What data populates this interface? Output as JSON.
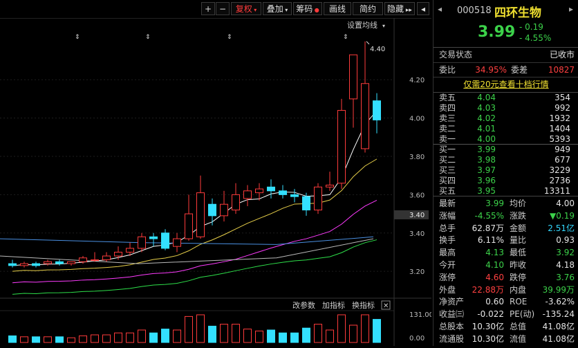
{
  "toolbar": {
    "plus": "+",
    "minus": "−",
    "fuquan": "复权",
    "diejia": "叠加",
    "chouma": "筹码",
    "huaxian": "画线",
    "jianyue": "简约",
    "yincang": "隐藏",
    "more": "▸▸"
  },
  "chart": {
    "settings_label": "设置均线",
    "peak_label": "4.40",
    "current_price_tag": "3.40",
    "price_ticks": [
      {
        "label": "4.20",
        "value": 4.2
      },
      {
        "label": "4.00",
        "value": 4.0
      },
      {
        "label": "3.80",
        "value": 3.8
      },
      {
        "label": "3.60",
        "value": 3.6
      },
      {
        "label": "3.40",
        "value": 3.4
      },
      {
        "label": "3.20",
        "value": 3.2
      }
    ],
    "indicator_buttons": [
      "改参数",
      "加指标",
      "换指标"
    ],
    "close_icon": "✕",
    "vol_ticks": [
      "131.00",
      "0.00"
    ]
  },
  "chart_data": {
    "type": "candlestick",
    "ylim": [
      3.15,
      4.45
    ],
    "candles": [
      {
        "o": 3.24,
        "h": 3.26,
        "l": 3.22,
        "c": 3.23
      },
      {
        "o": 3.23,
        "h": 3.25,
        "l": 3.22,
        "c": 3.24
      },
      {
        "o": 3.24,
        "h": 3.25,
        "l": 3.22,
        "c": 3.23
      },
      {
        "o": 3.24,
        "h": 3.26,
        "l": 3.23,
        "c": 3.25
      },
      {
        "o": 3.25,
        "h": 3.26,
        "l": 3.23,
        "c": 3.24
      },
      {
        "o": 3.24,
        "h": 3.25,
        "l": 3.23,
        "c": 3.25
      },
      {
        "o": 3.25,
        "h": 3.28,
        "l": 3.24,
        "c": 3.27
      },
      {
        "o": 3.26,
        "h": 3.3,
        "l": 3.25,
        "c": 3.26
      },
      {
        "o": 3.26,
        "h": 3.3,
        "l": 3.25,
        "c": 3.28
      },
      {
        "o": 3.28,
        "h": 3.33,
        "l": 3.26,
        "c": 3.3
      },
      {
        "o": 3.3,
        "h": 3.35,
        "l": 3.28,
        "c": 3.32
      },
      {
        "o": 3.32,
        "h": 3.4,
        "l": 3.3,
        "c": 3.38
      },
      {
        "o": 3.38,
        "h": 3.4,
        "l": 3.33,
        "c": 3.37
      },
      {
        "o": 3.4,
        "h": 3.42,
        "l": 3.31,
        "c": 3.32
      },
      {
        "o": 3.33,
        "h": 3.4,
        "l": 3.3,
        "c": 3.37
      },
      {
        "o": 3.37,
        "h": 3.6,
        "l": 3.36,
        "c": 3.5
      },
      {
        "o": 3.38,
        "h": 3.7,
        "l": 3.37,
        "c": 3.61
      },
      {
        "o": 3.55,
        "h": 3.58,
        "l": 3.44,
        "c": 3.49
      },
      {
        "o": 3.49,
        "h": 3.62,
        "l": 3.46,
        "c": 3.55
      },
      {
        "o": 3.52,
        "h": 3.66,
        "l": 3.5,
        "c": 3.6
      },
      {
        "o": 3.58,
        "h": 3.65,
        "l": 3.54,
        "c": 3.62
      },
      {
        "o": 3.61,
        "h": 3.66,
        "l": 3.57,
        "c": 3.63
      },
      {
        "o": 3.64,
        "h": 3.68,
        "l": 3.58,
        "c": 3.62
      },
      {
        "o": 3.62,
        "h": 3.65,
        "l": 3.58,
        "c": 3.6
      },
      {
        "o": 3.6,
        "h": 3.63,
        "l": 3.56,
        "c": 3.59
      },
      {
        "o": 3.59,
        "h": 3.61,
        "l": 3.49,
        "c": 3.52
      },
      {
        "o": 3.52,
        "h": 3.66,
        "l": 3.5,
        "c": 3.64
      },
      {
        "o": 3.64,
        "h": 3.72,
        "l": 3.62,
        "c": 3.65
      },
      {
        "o": 3.66,
        "h": 4.1,
        "l": 3.63,
        "c": 4.04
      },
      {
        "o": 4.1,
        "h": 4.1,
        "l": 3.95,
        "c": 4.33
      },
      {
        "o": 3.84,
        "h": 4.4,
        "l": 3.82,
        "c": 4.18
      },
      {
        "o": 4.09,
        "h": 4.13,
        "l": 3.92,
        "c": 3.99
      }
    ],
    "current_price": 3.99
  },
  "panel": {
    "code": "000518",
    "name": "四环生物",
    "price": "3.99",
    "change": "- 0.19",
    "change_pct": "- 4.55%",
    "trade_status_label": "交易状态",
    "trade_status_value": "已收市",
    "weibi_label": "委比",
    "weibi_value": "34.95%",
    "weicha_label": "委差",
    "weicha_value": "10827",
    "promo": "仅需20元查看十档行情",
    "asks": [
      {
        "label": "卖五",
        "price": "4.04",
        "vol": "354"
      },
      {
        "label": "卖四",
        "price": "4.03",
        "vol": "992"
      },
      {
        "label": "卖三",
        "price": "4.02",
        "vol": "1932"
      },
      {
        "label": "卖二",
        "price": "4.01",
        "vol": "1404"
      },
      {
        "label": "卖一",
        "price": "4.00",
        "vol": "5393"
      }
    ],
    "bids": [
      {
        "label": "买一",
        "price": "3.99",
        "vol": "949"
      },
      {
        "label": "买二",
        "price": "3.98",
        "vol": "677"
      },
      {
        "label": "买三",
        "price": "3.97",
        "vol": "3229"
      },
      {
        "label": "买四",
        "price": "3.96",
        "vol": "2736"
      },
      {
        "label": "买五",
        "price": "3.95",
        "vol": "13311"
      }
    ],
    "stats": [
      {
        "l1": "最新",
        "v1": "3.99",
        "c1": "grn",
        "l2": "均价",
        "v2": "4.00",
        "c2": "wht"
      },
      {
        "l1": "涨幅",
        "v1": "-4.55%",
        "c1": "grn",
        "l2": "涨跌",
        "v2": "▼0.19",
        "c2": "grn"
      },
      {
        "l1": "总手",
        "v1": "62.87万",
        "c1": "wht",
        "l2": "金额",
        "v2": "2.51亿",
        "c2": "cyan"
      },
      {
        "l1": "换手",
        "v1": "6.11%",
        "c1": "wht",
        "l2": "量比",
        "v2": "0.93",
        "c2": "wht"
      },
      {
        "l1": "最高",
        "v1": "4.13",
        "c1": "grn",
        "l2": "最低",
        "v2": "3.92",
        "c2": "grn"
      },
      {
        "l1": "今开",
        "v1": "4.10",
        "c1": "grn",
        "l2": "昨收",
        "v2": "4.18",
        "c2": "wht"
      },
      {
        "l1": "涨停",
        "v1": "4.60",
        "c1": "red",
        "l2": "跌停",
        "v2": "3.76",
        "c2": "grn"
      },
      {
        "l1": "外盘",
        "v1": "22.88万",
        "c1": "red",
        "l2": "内盘",
        "v2": "39.99万",
        "c2": "grn"
      },
      {
        "l1": "净资产",
        "v1": "0.60",
        "c1": "wht",
        "l2": "ROE",
        "v2": "-3.62%",
        "c2": "wht"
      },
      {
        "l1": "收益㈢",
        "v1": "-0.022",
        "c1": "wht",
        "l2": "PE(动)",
        "v2": "-135.24",
        "c2": "wht"
      },
      {
        "l1": "总股本",
        "v1": "10.30亿",
        "c1": "wht",
        "l2": "总值",
        "v2": "41.08亿",
        "c2": "wht"
      },
      {
        "l1": "流通股",
        "v1": "10.30亿",
        "c1": "wht",
        "l2": "流值",
        "v2": "41.08亿",
        "c2": "wht"
      }
    ]
  },
  "colors": {
    "up": "#ff3b3b",
    "down": "#33e0ff",
    "ma5": "#ffffff",
    "ma10": "#e8d04a",
    "ma20": "#ff3bff",
    "ma60": "#2ee04a"
  }
}
